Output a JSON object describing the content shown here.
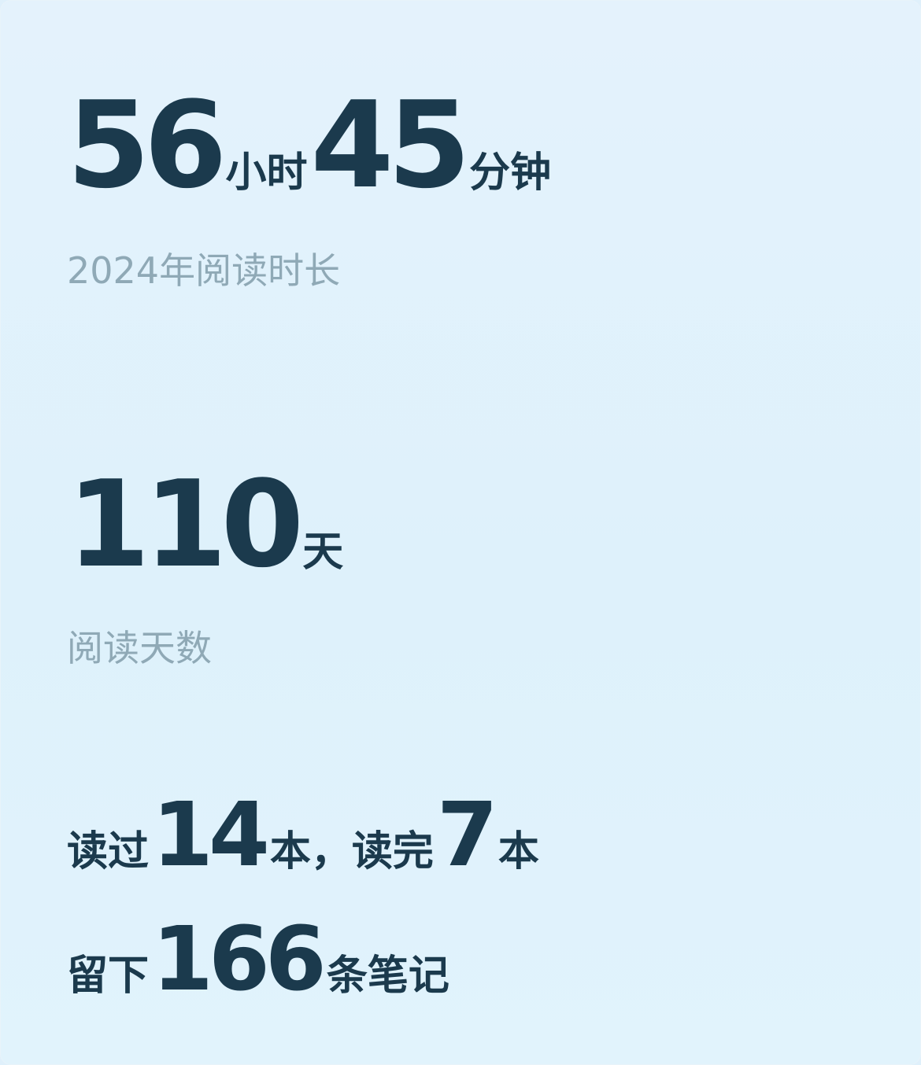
{
  "duration": {
    "hours_value": "56",
    "hours_unit": "小时",
    "minutes_value": "45",
    "minutes_unit": "分钟",
    "label": "2024年阅读时长"
  },
  "days": {
    "value": "110",
    "unit": "天",
    "label": "阅读天数"
  },
  "books": {
    "prefix": "读过",
    "read_count": "14",
    "mid_text": "本，读完",
    "finished_count": "7",
    "suffix": "本"
  },
  "notes": {
    "prefix": "留下",
    "count": "166",
    "suffix": "条笔记"
  }
}
